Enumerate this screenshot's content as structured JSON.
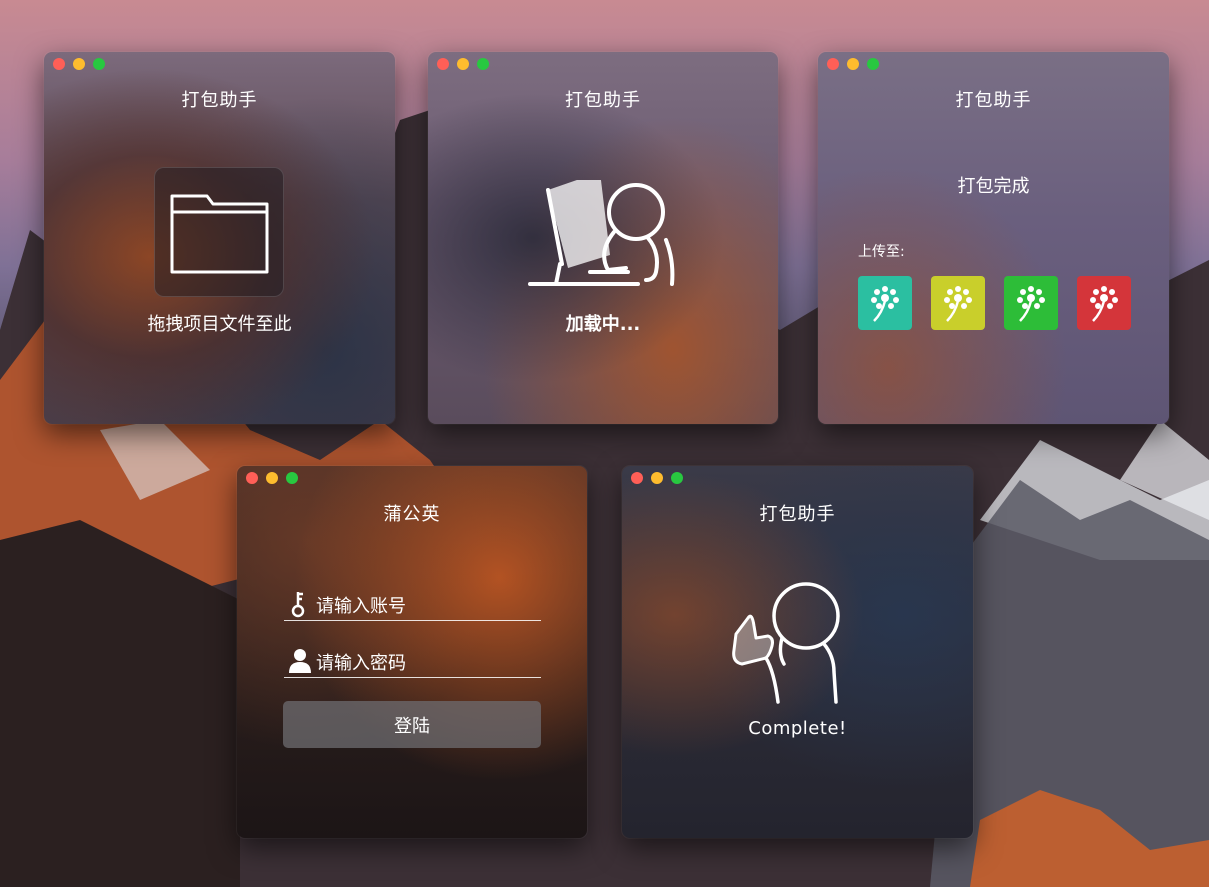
{
  "windows": {
    "drop": {
      "title": "打包助手",
      "label": "拖拽项目文件至此"
    },
    "loading": {
      "title": "打包助手",
      "label": "加载中..."
    },
    "done": {
      "title": "打包助手",
      "label": "打包完成",
      "upload_label": "上传至:",
      "targets": [
        {
          "icon": "dandelion-icon",
          "color": "#2bbfa1"
        },
        {
          "icon": "dandelion-icon",
          "color": "#c9cf2b"
        },
        {
          "icon": "dandelion-icon",
          "color": "#2dbd38"
        },
        {
          "icon": "dandelion-icon",
          "color": "#d4353a"
        }
      ]
    },
    "login": {
      "title": "蒲公英",
      "account_placeholder": "请输入账号",
      "password_placeholder": "请输入密码",
      "login_button": "登陆"
    },
    "complete": {
      "title": "打包助手",
      "label": "Complete!"
    }
  },
  "colors": {
    "traffic_red": "#ff5f57",
    "traffic_yellow": "#febc2e",
    "traffic_green": "#28c840"
  }
}
